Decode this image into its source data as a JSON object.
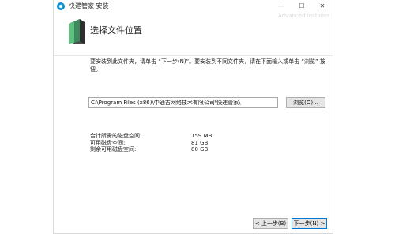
{
  "window": {
    "title": "快递管家 安装",
    "controls": {
      "minimize": "—",
      "maximize": "☐",
      "close": "✕"
    }
  },
  "header": {
    "title": "选择文件位置",
    "watermark": "Advanced Installer",
    "icon": "folder-icon"
  },
  "content": {
    "description": "要安装到此文件夹，请单击 “下一步(N)”。要安装到不同文件夹，请在下面输入或单击 “浏览” 按钮。",
    "install_path": "C:\\Program Files (x86)\\中通吉网络技术有限公司\\快递管家\\",
    "browse_label": "浏览(O)..."
  },
  "disk_space": [
    {
      "label": "合计所需的磁盘空间:",
      "value": "159 MB"
    },
    {
      "label": "可用磁盘空间:",
      "value": "81 GB"
    },
    {
      "label": "剩余可用磁盘空间:",
      "value": "80 GB"
    }
  ],
  "footer": {
    "back_label": "< 上一步(B)",
    "next_label": "下一步(N) >"
  },
  "colors": {
    "accent": "#0078d7",
    "app_icon": "#19a7e6",
    "folder": "#3a8a5c"
  }
}
